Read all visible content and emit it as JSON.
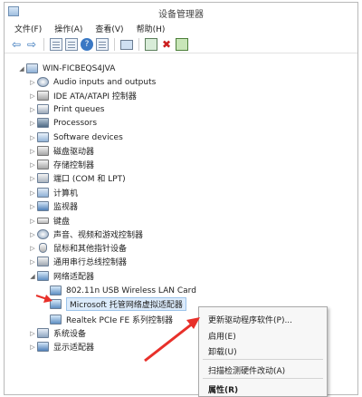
{
  "window": {
    "title": "设备管理器"
  },
  "menu": [
    "文件(F)",
    "操作(A)",
    "查看(V)",
    "帮助(H)"
  ],
  "toolbar_icons": [
    "back-arrow-icon",
    "forward-arrow-icon",
    "properties-icon",
    "document-icon",
    "help-icon",
    "document-icon",
    "monitor-icon",
    "scan-icon",
    "uninstall-icon",
    "update-driver-icon"
  ],
  "tree": {
    "root": "WIN-FICBEQS4JVA",
    "categories": [
      "Audio inputs and outputs",
      "IDE ATA/ATAPI 控制器",
      "Print queues",
      "Processors",
      "Software devices",
      "磁盘驱动器",
      "存储控制器",
      "端口 (COM 和 LPT)",
      "计算机",
      "监视器",
      "键盘",
      "声音、视频和游戏控制器",
      "鼠标和其他指针设备",
      "通用串行总线控制器",
      "网络适配器"
    ],
    "network_children": [
      "802.11n USB Wireless LAN Card",
      "Microsoft 托管网络虚拟适配器",
      "Realtek PCIe FE 系列控制器"
    ],
    "after": [
      "系统设备",
      "显示适配器"
    ]
  },
  "context_menu": {
    "items": [
      "更新驱动程序软件(P)...",
      "启用(E)",
      "卸载(U)",
      "扫描检测硬件改动(A)",
      "属性(R)"
    ]
  },
  "colors": {
    "selection": "#dcebfb",
    "annotation_arrow": "#e8302a"
  }
}
